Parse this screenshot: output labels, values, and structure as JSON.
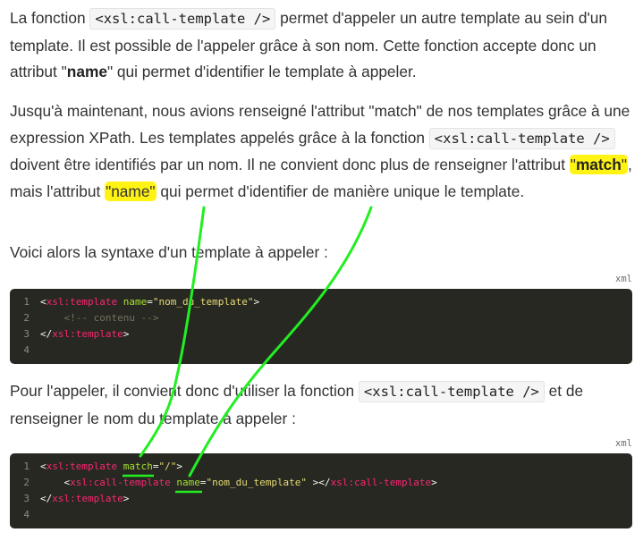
{
  "para1": {
    "t1": "La fonction ",
    "code1": "<xsl:call-template />",
    "t2": " permet d'appeler un autre template au sein d'un template. Il est possible de l'appeler grâce à son nom. Cette fonction accepte donc un attribut \"",
    "bold": "name",
    "t3": "\" qui permet d'identifier le template à appeler."
  },
  "para2": {
    "t1": "Jusqu'à maintenant, nous avions renseigné l'attribut \"match\" de nos templates grâce à une expression XPath. Les templates appelés grâce à la fonction ",
    "code1": "<xsl:call-template />",
    "t2": " doivent être identifiés par un nom. Il ne convient donc plus de renseigner l'attribut ",
    "hl1_q1": "\"",
    "hl1_bold": "match",
    "hl1_q2": "\"",
    "t3": ", mais l'attribut ",
    "hl2": "\"name\"",
    "t4": " qui permet d'identifier de manière unique le template."
  },
  "para3": {
    "text": "Voici alors la syntaxe d'un template à appeler :"
  },
  "code_block1": {
    "lang": "xml",
    "lines": [
      {
        "n": "1",
        "t1": "<",
        "tag": "xsl:template",
        "attr": " name",
        "eq": "=",
        "str": "\"nom_du_template\"",
        "t2": ">"
      },
      {
        "n": "2",
        "comment": "    <!-- contenu -->"
      },
      {
        "n": "3",
        "t1": "</",
        "tag": "xsl:template",
        "t2": ">"
      },
      {
        "n": "4"
      }
    ]
  },
  "para4": {
    "t1": "Pour l'appeler, il convient donc d'utiliser la fonction ",
    "code1": "<xsl:call-template />",
    "t2": " et de renseigner le nom du template à appeler :"
  },
  "code_block2": {
    "lang": "xml",
    "lines": [
      {
        "n": "1",
        "t1": "<",
        "tag": "xsl:template",
        "sp": " ",
        "attr": "match",
        "eq": "=",
        "str": "\"/\"",
        "t2": ">"
      },
      {
        "n": "2",
        "indent": "    ",
        "t1": "<",
        "tag": "xsl:call-template",
        "sp": " ",
        "attr": "name",
        "eq": "=",
        "str": "\"nom_du_template\"",
        "t2": " ></",
        "tag2": "xsl:call-template",
        "t3": ">"
      },
      {
        "n": "3",
        "t1": "</",
        "tag": "xsl:template",
        "t2": ">"
      },
      {
        "n": "4"
      }
    ]
  },
  "annotation_color": "#22ee22",
  "highlight_color": "#fff314"
}
